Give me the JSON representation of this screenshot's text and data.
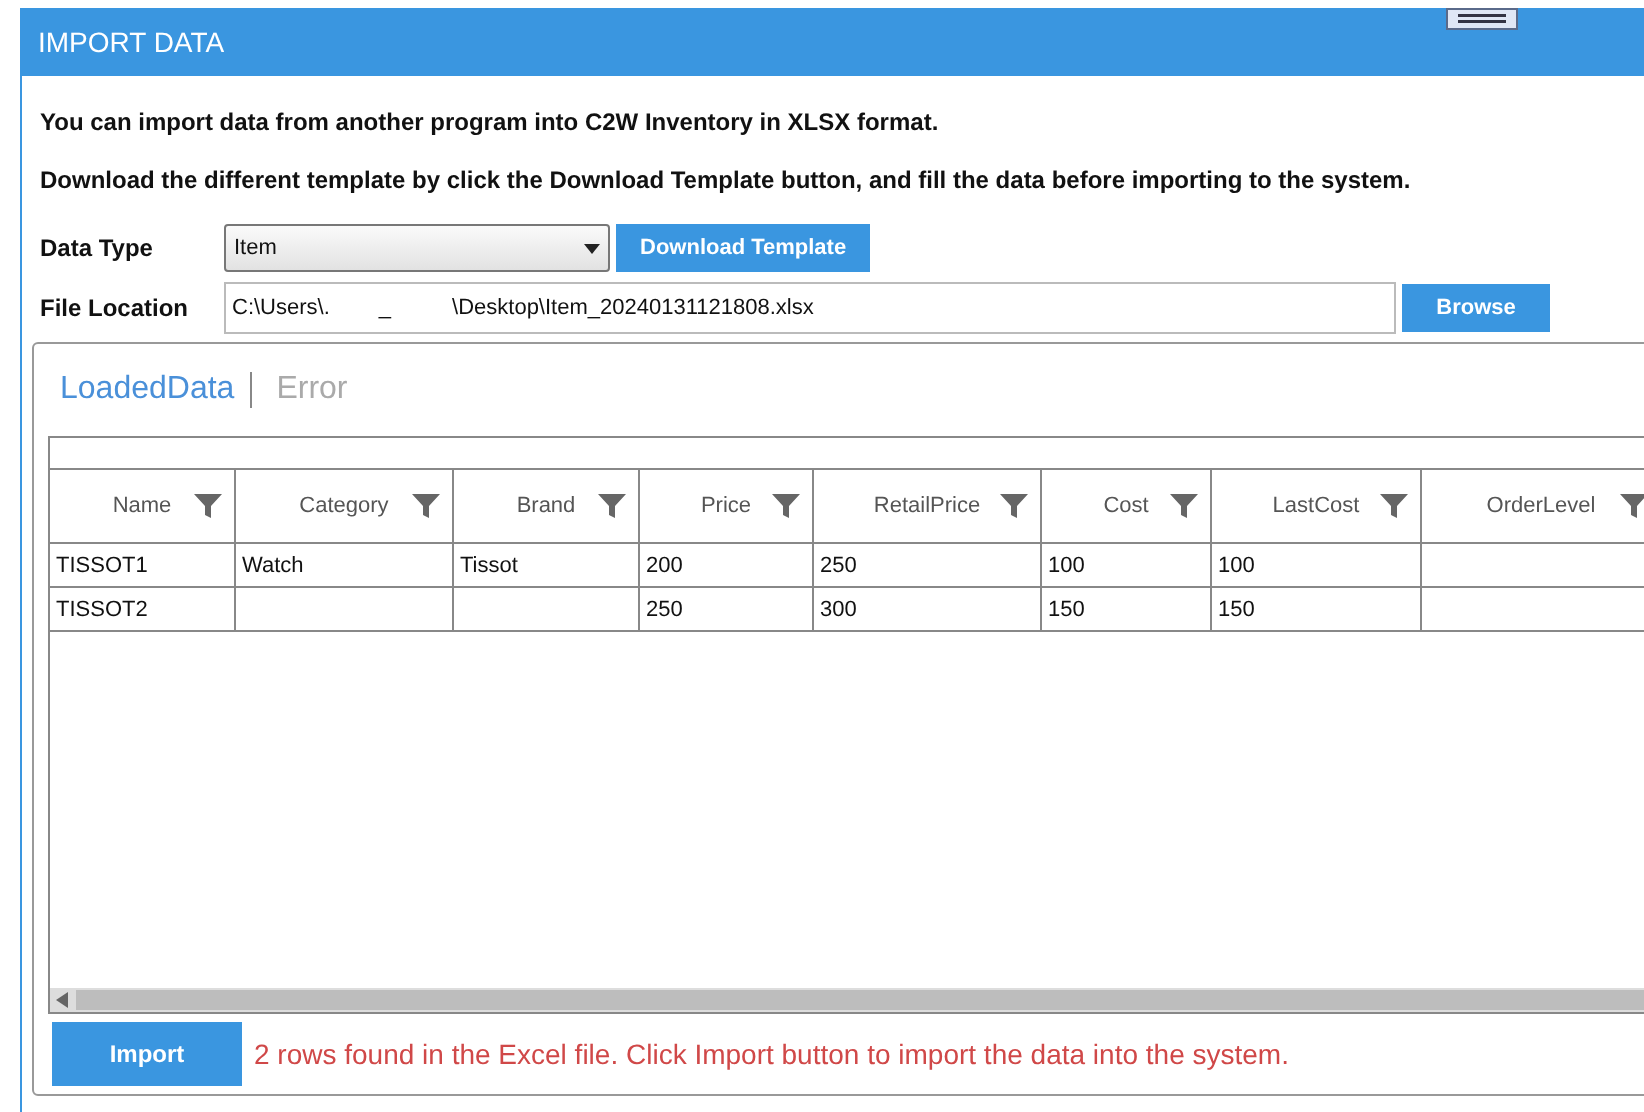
{
  "window": {
    "title": "IMPORT DATA"
  },
  "intro": [
    "You can import data from another program into C2W Inventory in XLSX format.",
    "Download the different template by click the Download Template button, and fill the data before importing to the system."
  ],
  "data_type": {
    "label": "Data Type",
    "value": "Item",
    "button": "Download Template"
  },
  "file_location": {
    "label": "File Location",
    "value": "C:\\Users\\.        _          \\Desktop\\Item_20240131121808.xlsx",
    "button": "Browse"
  },
  "tabs": [
    {
      "label": "LoadedData",
      "selected": true
    },
    {
      "label": "Error",
      "selected": false
    }
  ],
  "table": {
    "columns": [
      "Name",
      "Category",
      "Brand",
      "Price",
      "RetailPrice",
      "Cost",
      "LastCost",
      "OrderLevel"
    ],
    "rows": [
      [
        "TISSOT1",
        "Watch",
        "Tissot",
        "200",
        "250",
        "100",
        "100",
        null
      ],
      [
        "TISSOT2",
        null,
        null,
        "250",
        "300",
        "150",
        "150",
        null
      ]
    ]
  },
  "import_button": "Import",
  "message": "2 rows found in the Excel file. Click Import button to import the data into the system."
}
